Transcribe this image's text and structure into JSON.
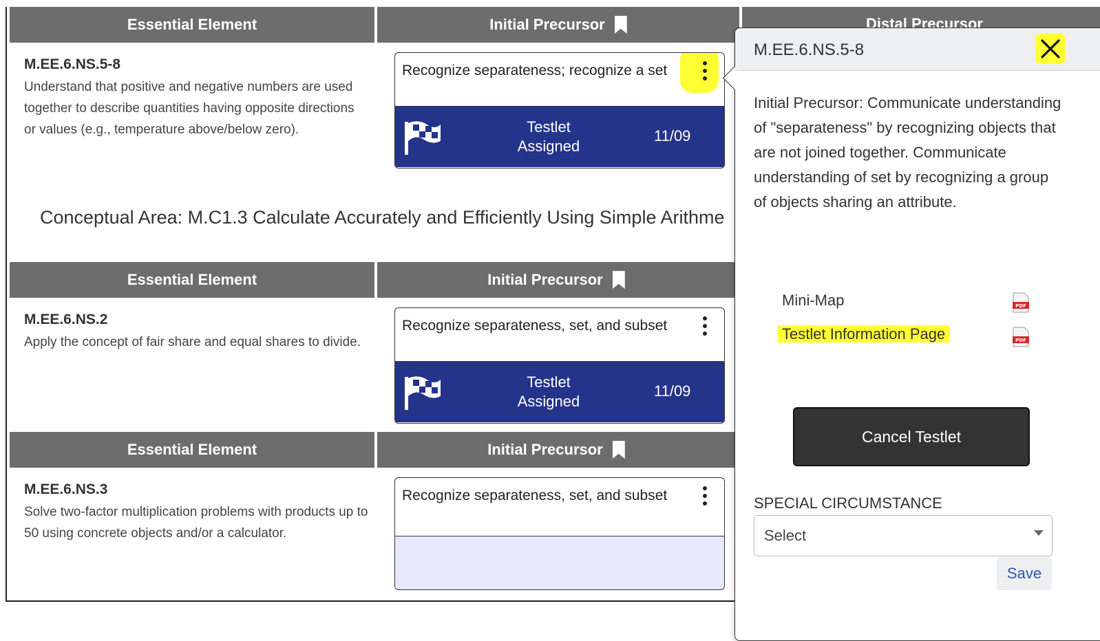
{
  "headers": {
    "essential_element": "Essential Element",
    "initial_precursor": "Initial Precursor",
    "distal_precursor": "Distal Precursor"
  },
  "concept_area": "Conceptual Area: M.C1.3 Calculate Accurately and Efficiently Using Simple Arithme",
  "rows": [
    {
      "code": "M.EE.6.NS.5-8",
      "description": "Understand that positive and negative numbers are used together to describe quantities having opposite directions or values (e.g., temperature above/below zero).",
      "precursor_text": "Recognize separateness; recognize a set",
      "testlet_status": "Testlet Assigned",
      "testlet_date": "11/09"
    },
    {
      "code": "M.EE.6.NS.2",
      "description": "Apply the concept of fair share and equal shares to divide.",
      "precursor_text": "Recognize separateness, set, and subset",
      "testlet_status": "Testlet Assigned",
      "testlet_date": "11/09"
    },
    {
      "code": "M.EE.6.NS.3",
      "description": "Solve two-factor multiplication problems with products up to 50 using concrete objects and/or a calculator.",
      "precursor_text": "Recognize separateness, set, and subset",
      "testlet_status": "",
      "testlet_date": ""
    }
  ],
  "popover": {
    "title": "M.EE.6.NS.5-8",
    "close_icon": "close-icon",
    "description": "Initial Precursor: Communicate understanding of \"separateness\" by recognizing objects that are not joined together. Communicate understanding of set by recognizing a group of objects sharing an attribute.",
    "resources": [
      {
        "label": "Mini-Map",
        "icon": "pdf-icon"
      },
      {
        "label": "Testlet Information Page",
        "icon": "pdf-icon",
        "highlighted": true
      }
    ],
    "cancel_label": "Cancel Testlet",
    "special_circumstance_label": "SPECIAL CIRCUMSTANCE",
    "select_value": "Select",
    "save_label": "Save"
  },
  "colors": {
    "header_bg": "#6d6d6d",
    "testlet_bg": "#24348b",
    "empty_bg": "#e6e8fb",
    "highlight": "#ffff33",
    "save_text": "#2a56b0"
  }
}
